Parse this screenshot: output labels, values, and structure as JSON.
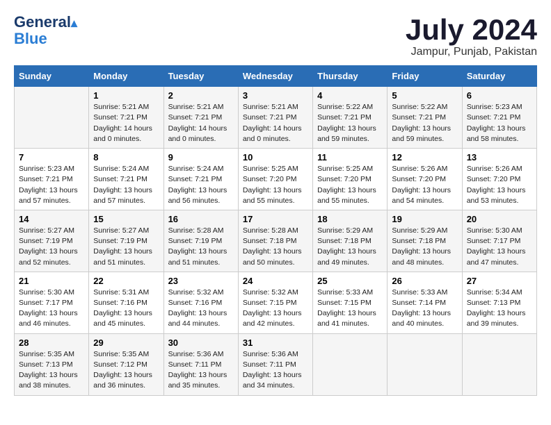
{
  "header": {
    "logo_general": "General",
    "logo_blue": "Blue",
    "month_year": "July 2024",
    "location": "Jampur, Punjab, Pakistan"
  },
  "columns": [
    "Sunday",
    "Monday",
    "Tuesday",
    "Wednesday",
    "Thursday",
    "Friday",
    "Saturday"
  ],
  "weeks": [
    [
      {
        "day": "",
        "info": ""
      },
      {
        "day": "1",
        "info": "Sunrise: 5:21 AM\nSunset: 7:21 PM\nDaylight: 14 hours\nand 0 minutes."
      },
      {
        "day": "2",
        "info": "Sunrise: 5:21 AM\nSunset: 7:21 PM\nDaylight: 14 hours\nand 0 minutes."
      },
      {
        "day": "3",
        "info": "Sunrise: 5:21 AM\nSunset: 7:21 PM\nDaylight: 14 hours\nand 0 minutes."
      },
      {
        "day": "4",
        "info": "Sunrise: 5:22 AM\nSunset: 7:21 PM\nDaylight: 13 hours\nand 59 minutes."
      },
      {
        "day": "5",
        "info": "Sunrise: 5:22 AM\nSunset: 7:21 PM\nDaylight: 13 hours\nand 59 minutes."
      },
      {
        "day": "6",
        "info": "Sunrise: 5:23 AM\nSunset: 7:21 PM\nDaylight: 13 hours\nand 58 minutes."
      }
    ],
    [
      {
        "day": "7",
        "info": "Sunrise: 5:23 AM\nSunset: 7:21 PM\nDaylight: 13 hours\nand 57 minutes."
      },
      {
        "day": "8",
        "info": "Sunrise: 5:24 AM\nSunset: 7:21 PM\nDaylight: 13 hours\nand 57 minutes."
      },
      {
        "day": "9",
        "info": "Sunrise: 5:24 AM\nSunset: 7:21 PM\nDaylight: 13 hours\nand 56 minutes."
      },
      {
        "day": "10",
        "info": "Sunrise: 5:25 AM\nSunset: 7:20 PM\nDaylight: 13 hours\nand 55 minutes."
      },
      {
        "day": "11",
        "info": "Sunrise: 5:25 AM\nSunset: 7:20 PM\nDaylight: 13 hours\nand 55 minutes."
      },
      {
        "day": "12",
        "info": "Sunrise: 5:26 AM\nSunset: 7:20 PM\nDaylight: 13 hours\nand 54 minutes."
      },
      {
        "day": "13",
        "info": "Sunrise: 5:26 AM\nSunset: 7:20 PM\nDaylight: 13 hours\nand 53 minutes."
      }
    ],
    [
      {
        "day": "14",
        "info": "Sunrise: 5:27 AM\nSunset: 7:19 PM\nDaylight: 13 hours\nand 52 minutes."
      },
      {
        "day": "15",
        "info": "Sunrise: 5:27 AM\nSunset: 7:19 PM\nDaylight: 13 hours\nand 51 minutes."
      },
      {
        "day": "16",
        "info": "Sunrise: 5:28 AM\nSunset: 7:19 PM\nDaylight: 13 hours\nand 51 minutes."
      },
      {
        "day": "17",
        "info": "Sunrise: 5:28 AM\nSunset: 7:18 PM\nDaylight: 13 hours\nand 50 minutes."
      },
      {
        "day": "18",
        "info": "Sunrise: 5:29 AM\nSunset: 7:18 PM\nDaylight: 13 hours\nand 49 minutes."
      },
      {
        "day": "19",
        "info": "Sunrise: 5:29 AM\nSunset: 7:18 PM\nDaylight: 13 hours\nand 48 minutes."
      },
      {
        "day": "20",
        "info": "Sunrise: 5:30 AM\nSunset: 7:17 PM\nDaylight: 13 hours\nand 47 minutes."
      }
    ],
    [
      {
        "day": "21",
        "info": "Sunrise: 5:30 AM\nSunset: 7:17 PM\nDaylight: 13 hours\nand 46 minutes."
      },
      {
        "day": "22",
        "info": "Sunrise: 5:31 AM\nSunset: 7:16 PM\nDaylight: 13 hours\nand 45 minutes."
      },
      {
        "day": "23",
        "info": "Sunrise: 5:32 AM\nSunset: 7:16 PM\nDaylight: 13 hours\nand 44 minutes."
      },
      {
        "day": "24",
        "info": "Sunrise: 5:32 AM\nSunset: 7:15 PM\nDaylight: 13 hours\nand 42 minutes."
      },
      {
        "day": "25",
        "info": "Sunrise: 5:33 AM\nSunset: 7:15 PM\nDaylight: 13 hours\nand 41 minutes."
      },
      {
        "day": "26",
        "info": "Sunrise: 5:33 AM\nSunset: 7:14 PM\nDaylight: 13 hours\nand 40 minutes."
      },
      {
        "day": "27",
        "info": "Sunrise: 5:34 AM\nSunset: 7:13 PM\nDaylight: 13 hours\nand 39 minutes."
      }
    ],
    [
      {
        "day": "28",
        "info": "Sunrise: 5:35 AM\nSunset: 7:13 PM\nDaylight: 13 hours\nand 38 minutes."
      },
      {
        "day": "29",
        "info": "Sunrise: 5:35 AM\nSunset: 7:12 PM\nDaylight: 13 hours\nand 36 minutes."
      },
      {
        "day": "30",
        "info": "Sunrise: 5:36 AM\nSunset: 7:11 PM\nDaylight: 13 hours\nand 35 minutes."
      },
      {
        "day": "31",
        "info": "Sunrise: 5:36 AM\nSunset: 7:11 PM\nDaylight: 13 hours\nand 34 minutes."
      },
      {
        "day": "",
        "info": ""
      },
      {
        "day": "",
        "info": ""
      },
      {
        "day": "",
        "info": ""
      }
    ]
  ]
}
